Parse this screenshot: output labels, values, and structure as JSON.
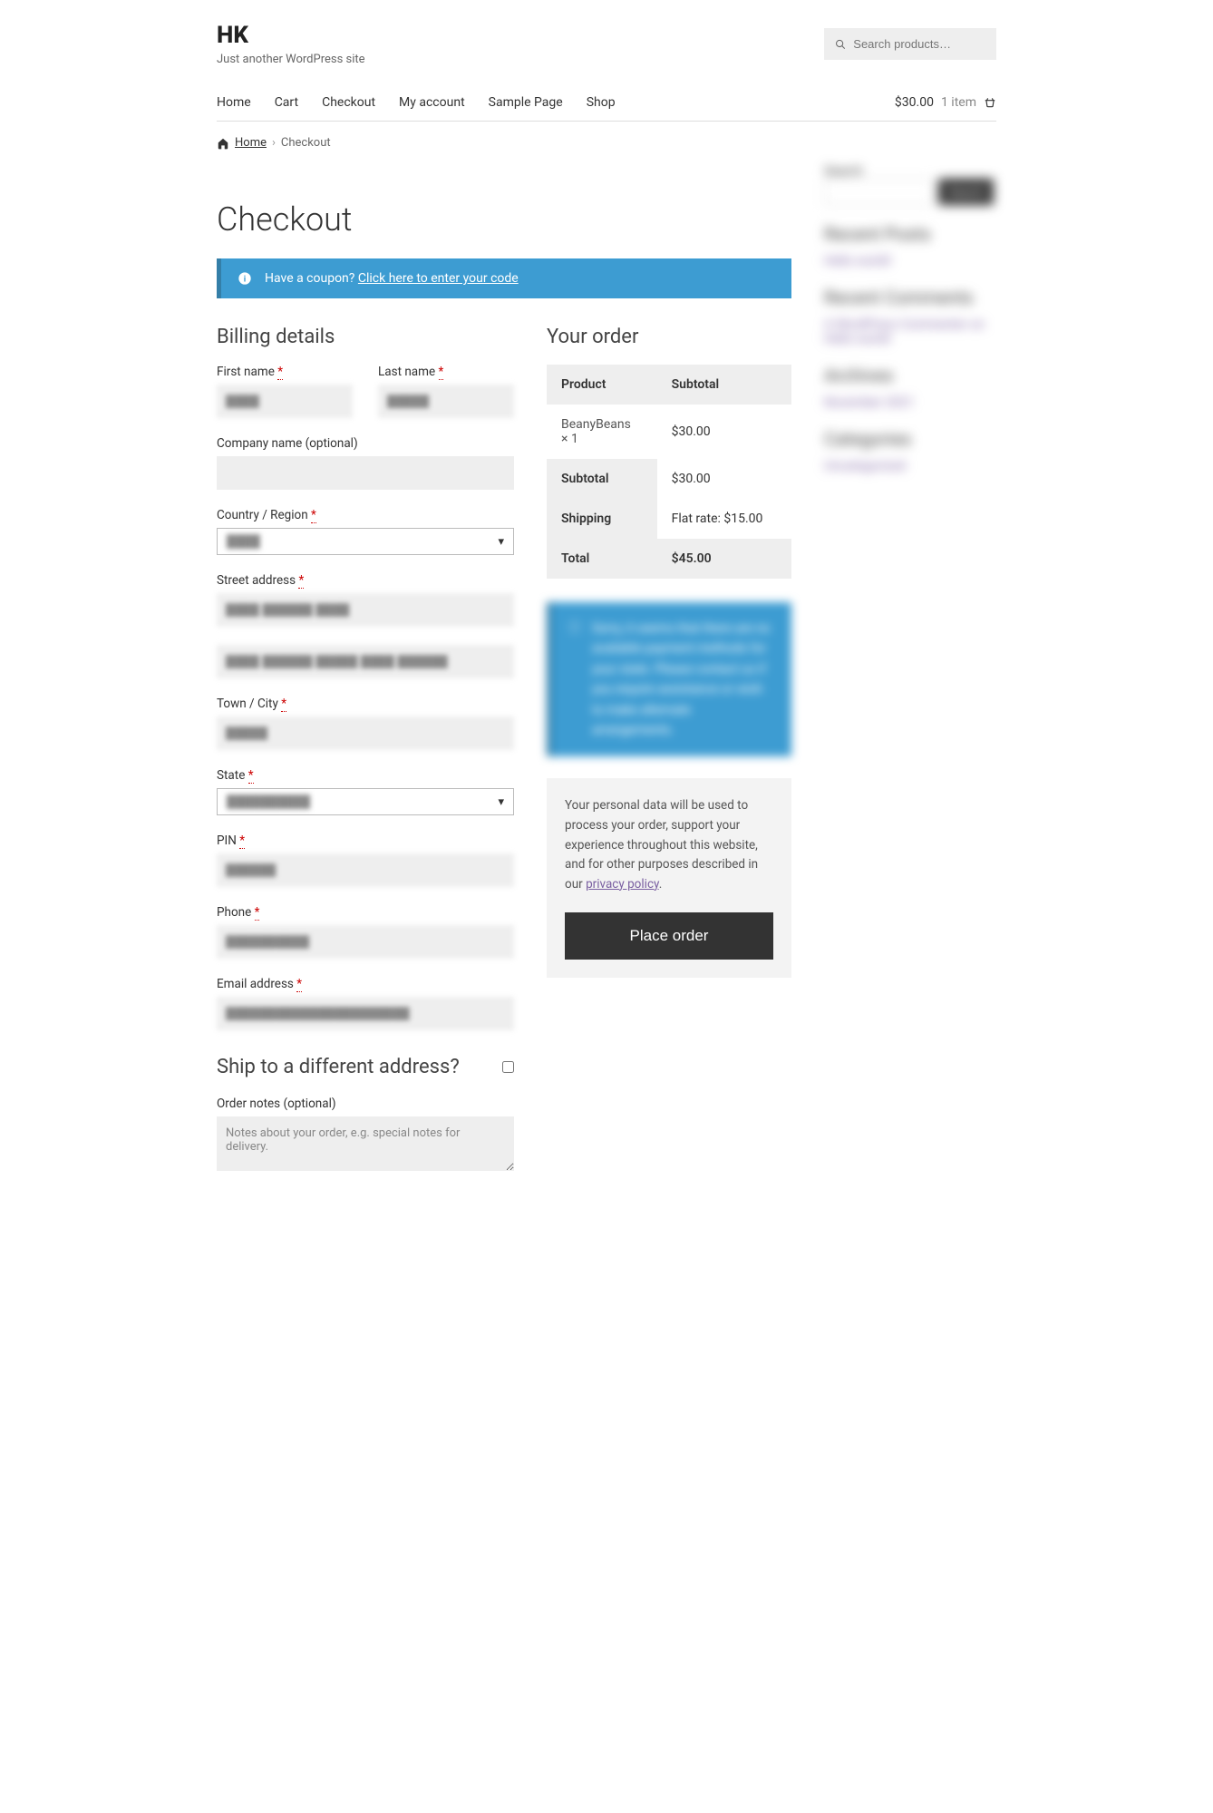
{
  "site": {
    "title": "HK",
    "tagline": "Just another WordPress site"
  },
  "search": {
    "placeholder": "Search products…"
  },
  "nav": [
    "Home",
    "Cart",
    "Checkout",
    "My account",
    "Sample Page",
    "Shop"
  ],
  "cart": {
    "total": "$30.00",
    "count": "1 item"
  },
  "breadcrumb": {
    "home": "Home",
    "current": "Checkout"
  },
  "page_title": "Checkout",
  "coupon": {
    "prompt": "Have a coupon?",
    "link": "Click here to enter your code"
  },
  "billing": {
    "heading": "Billing details",
    "first_name": {
      "label": "First name"
    },
    "last_name": {
      "label": "Last name"
    },
    "company": {
      "label": "Company name (optional)"
    },
    "country": {
      "label": "Country / Region"
    },
    "street": {
      "label": "Street address"
    },
    "city": {
      "label": "Town / City"
    },
    "state": {
      "label": "State"
    },
    "pin": {
      "label": "PIN"
    },
    "phone": {
      "label": "Phone"
    },
    "email": {
      "label": "Email address"
    }
  },
  "ship": {
    "heading": "Ship to a different address?",
    "notes_label": "Order notes (optional)",
    "notes_placeholder": "Notes about your order, e.g. special notes for delivery."
  },
  "order": {
    "heading": "Your order",
    "col_product": "Product",
    "col_subtotal": "Subtotal",
    "item_name": "BeanyBeans",
    "item_qty": "× 1",
    "item_price": "$30.00",
    "subtotal_label": "Subtotal",
    "subtotal_value": "$30.00",
    "shipping_label": "Shipping",
    "shipping_value": "Flat rate: $15.00",
    "total_label": "Total",
    "total_value": "$45.00"
  },
  "payment_notice": "Sorry, it seems that there are no available payment methods for your state. Please contact us if you require assistance or wish to make alternate arrangements.",
  "privacy": {
    "text": "Your personal data will be used to process your order, support your experience throughout this website, and for other purposes described in our ",
    "link": "privacy policy"
  },
  "place_order": "Place order",
  "sidebar": {
    "search_label": "Search",
    "search_btn": "Search",
    "recent_posts": "Recent Posts",
    "recent_posts_item": "Hello world!",
    "recent_comments": "Recent Comments",
    "recent_comments_item": "A WordPress Commenter on Hello world!",
    "archives": "Archives",
    "archives_item": "November 2021",
    "categories": "Categories",
    "categories_item": "Uncategorized"
  }
}
